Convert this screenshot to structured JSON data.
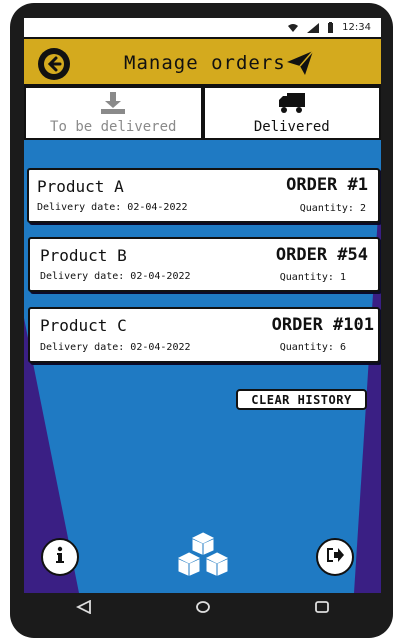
{
  "status_bar": {
    "time": "12:34",
    "icons": [
      "wifi-icon",
      "signal-icon",
      "battery-icon"
    ]
  },
  "header": {
    "title": "Manage orders",
    "back_icon": "back-arrow-icon",
    "action_icon": "paper-plane-icon"
  },
  "tabs": [
    {
      "label": "To be delivered",
      "icon": "download-tray-icon",
      "active": false
    },
    {
      "label": "Delivered",
      "icon": "truck-icon",
      "active": true
    }
  ],
  "orders": [
    {
      "product": "Product A",
      "delivery": "Delivery date: 02-04-2022",
      "order": "ORDER #1",
      "quantity": "Quantity: 2"
    },
    {
      "product": "Product B",
      "delivery": "Delivery date: 02-04-2022",
      "order": "ORDER #54",
      "quantity": "Quantity: 1"
    },
    {
      "product": "Product C",
      "delivery": "Delivery date: 02-04-2022",
      "order": "ORDER #101",
      "quantity": "Quantity: 6"
    }
  ],
  "clear_history_label": "CLEAR HISTORY",
  "bottom_bar": {
    "info_icon": "info-icon",
    "center_icon": "boxes-icon",
    "logout_icon": "logout-icon"
  },
  "colors": {
    "header": "#d4aa1e",
    "background": "#3a1f84",
    "stripe": "#1f7ac3"
  }
}
